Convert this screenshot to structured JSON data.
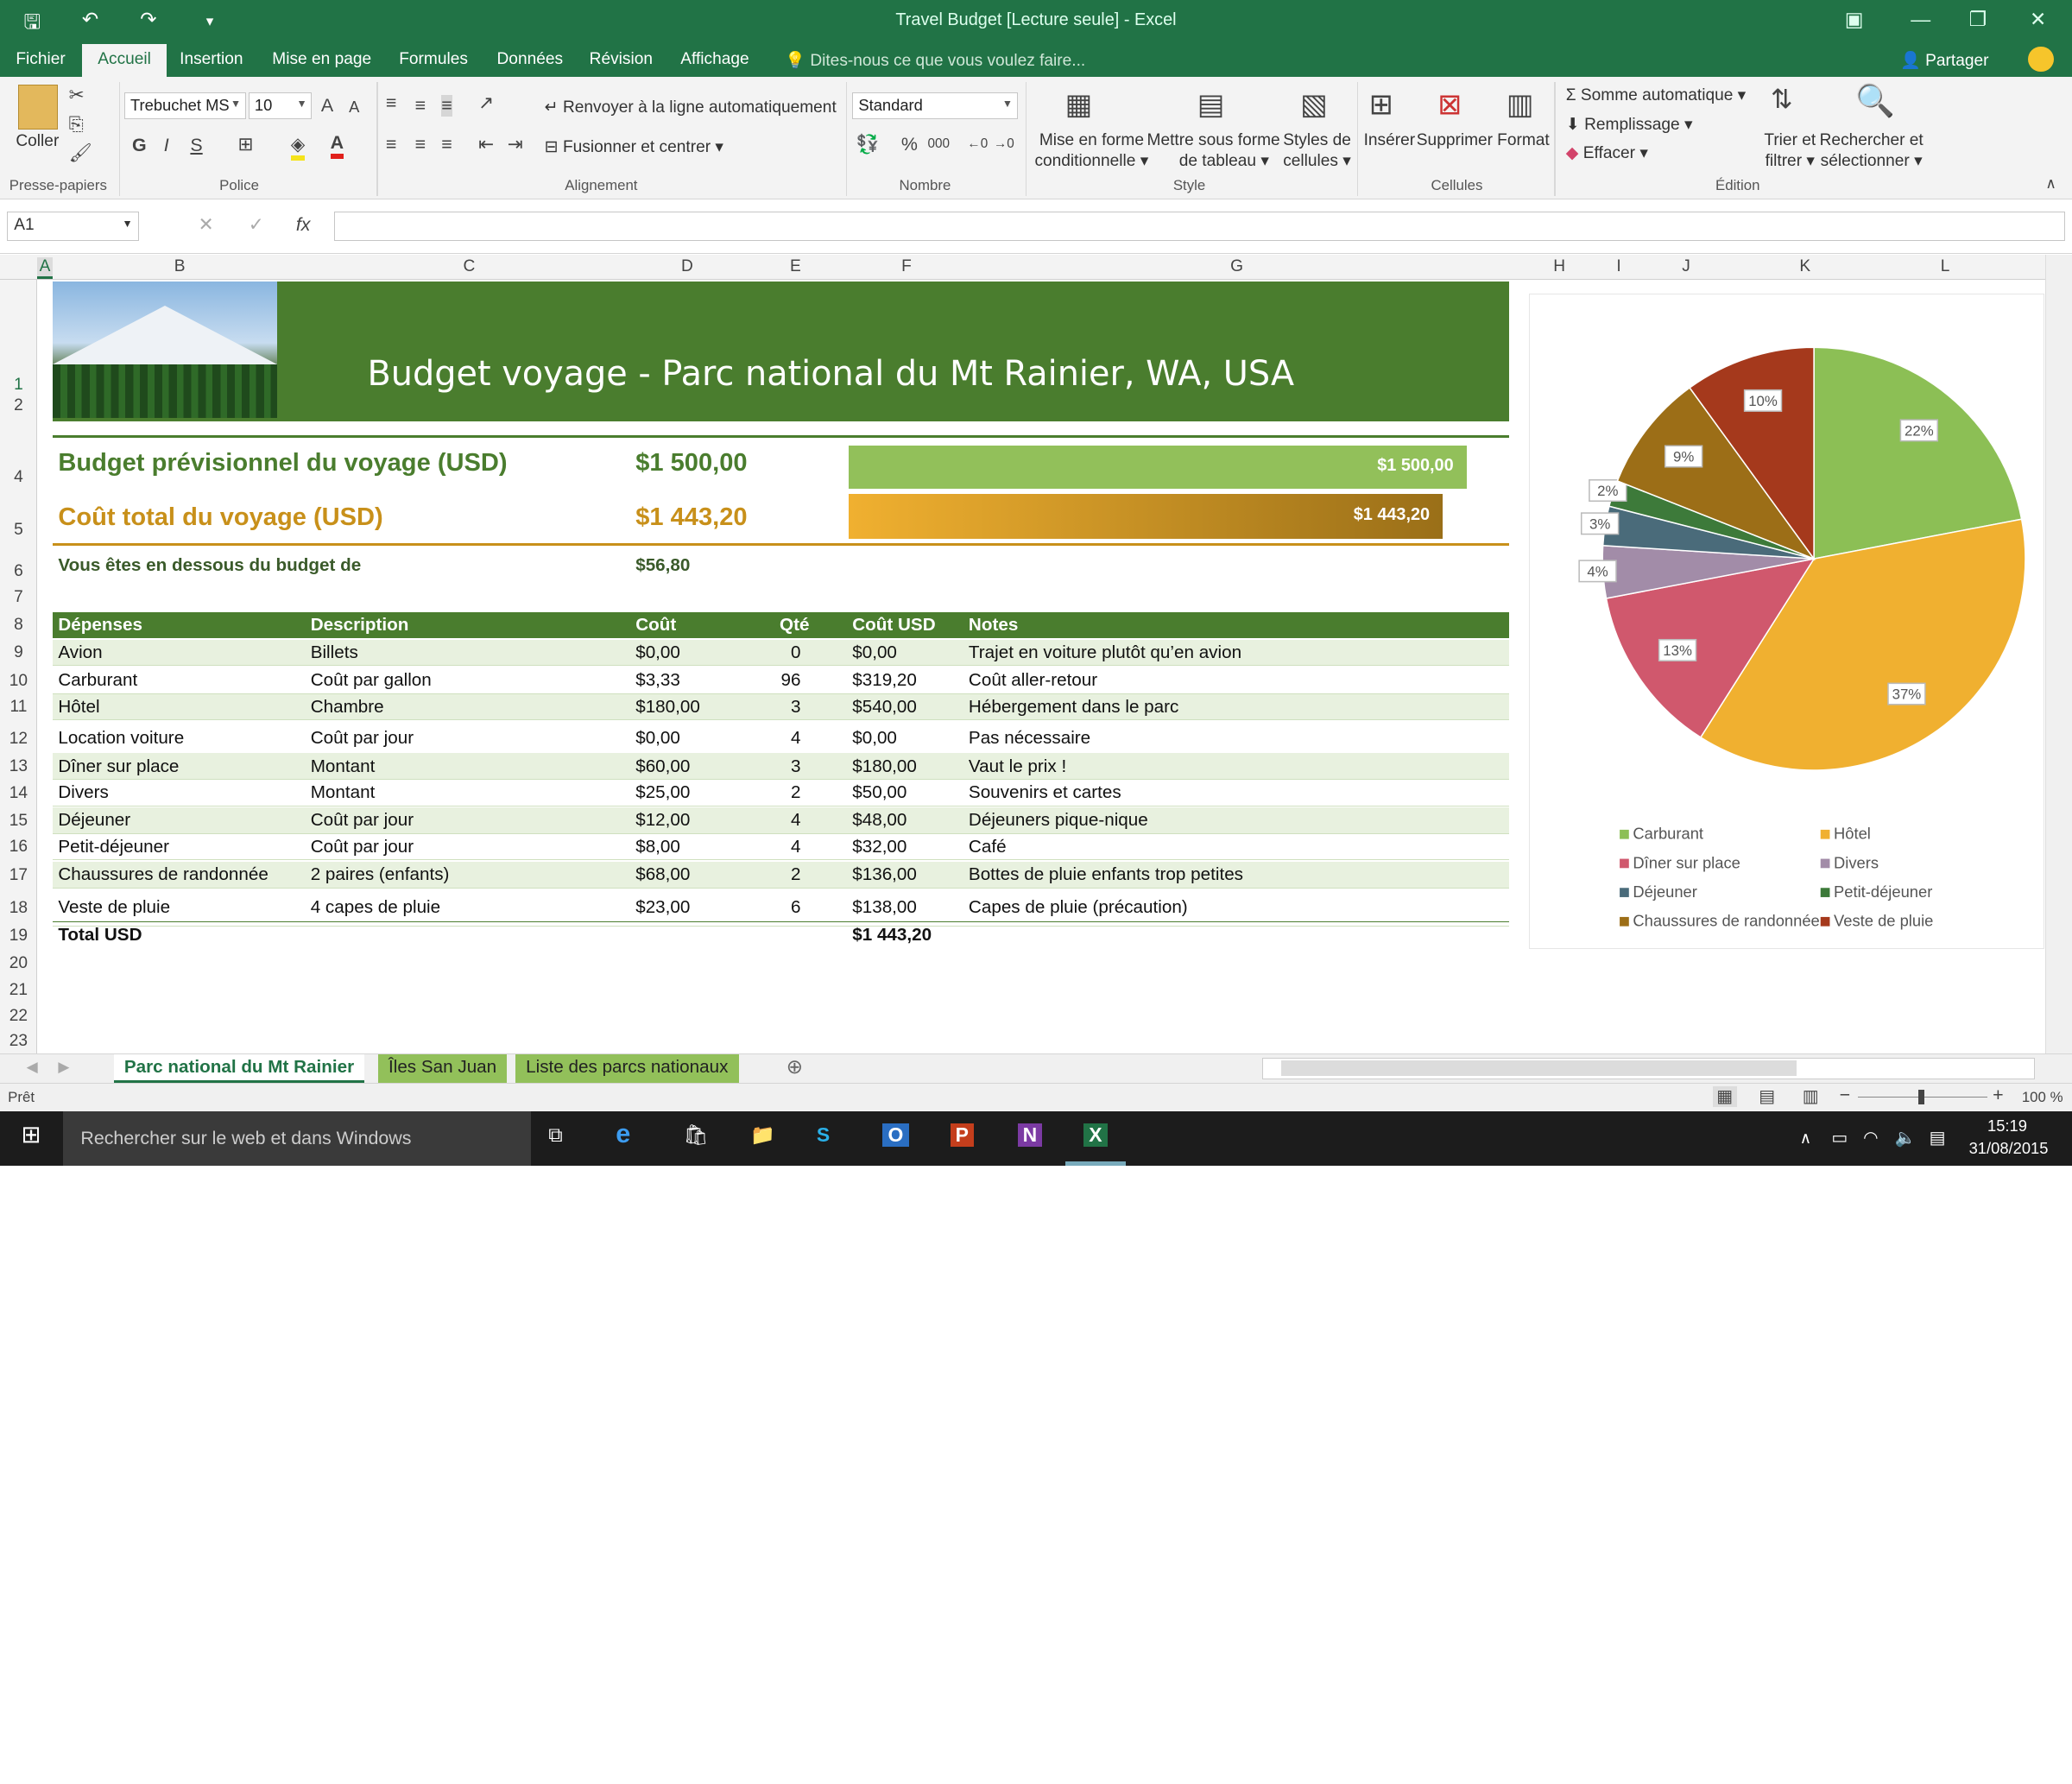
{
  "window": {
    "title": "Travel Budget  [Lecture seule] - Excel"
  },
  "menu": {
    "file": "Fichier",
    "home": "Accueil",
    "insert": "Insertion",
    "layout": "Mise en page",
    "formulas": "Formules",
    "data": "Données",
    "review": "Révision",
    "view": "Affichage",
    "tellme": "Dites-nous ce que vous voulez faire...",
    "share": "Partager"
  },
  "ribbon": {
    "paste": "Coller",
    "font_name": "Trebuchet MS",
    "font_size": "10",
    "wrap": "Renvoyer à la ligne automatiquement",
    "merge": "Fusionner et centrer",
    "number_format": "Standard",
    "cond_format": "Mise en forme",
    "cond_format2": "conditionnelle",
    "format_table": "Mettre sous forme",
    "format_table2": "de tableau",
    "cell_styles": "Styles de",
    "cell_styles2": "cellules",
    "insert": "Insérer",
    "delete": "Supprimer",
    "format": "Format",
    "autosum": "Somme automatique",
    "fill": "Remplissage",
    "clear": "Effacer",
    "sort": "Trier et",
    "sort2": "filtrer",
    "find": "Rechercher et",
    "find2": "sélectionner",
    "groups": {
      "clipboard": "Presse-papiers",
      "font": "Police",
      "alignment": "Alignement",
      "number": "Nombre",
      "style": "Style",
      "cells": "Cellules",
      "editing": "Édition"
    }
  },
  "formula_bar": {
    "name_box": "A1",
    "value": ""
  },
  "columns": [
    "A",
    "B",
    "C",
    "D",
    "E",
    "F",
    "G",
    "H",
    "I",
    "J",
    "K",
    "L"
  ],
  "rows": [
    "1",
    "2",
    "4",
    "5",
    "6",
    "7",
    "8",
    "9",
    "10",
    "11",
    "12",
    "13",
    "14",
    "15",
    "16",
    "17",
    "18",
    "19",
    "20",
    "21",
    "22",
    "23"
  ],
  "sheet": {
    "title": "Budget voyage - Parc national du Mt Rainier, WA, USA",
    "budget_label": "Budget prévisionnel du voyage (USD)",
    "budget_value": "$1 500,00",
    "budget_bar": "$1 500,00",
    "cost_label": "Coût total du voyage (USD)",
    "cost_value": "$1 443,20",
    "cost_bar": "$1 443,20",
    "under_label": "Vous êtes en dessous du budget de",
    "under_value": "$56,80",
    "bar_fraction_budget": 1.0,
    "bar_fraction_cost": 0.962,
    "table_headers": [
      "Dépenses",
      "Description",
      "Coût",
      "Qté",
      "Coût USD",
      "Notes"
    ],
    "table_rows": [
      [
        "Avion",
        "Billets",
        "$0,00",
        "0",
        "$0,00",
        "Trajet en voiture plutôt qu’en avion"
      ],
      [
        "Carburant",
        "Coût par gallon",
        "$3,33",
        "96",
        "$319,20",
        "Coût aller-retour"
      ],
      [
        "Hôtel",
        "Chambre",
        "$180,00",
        "3",
        "$540,00",
        "Hébergement dans le parc"
      ],
      [
        "Location voiture",
        "Coût par jour",
        "$0,00",
        "4",
        "$0,00",
        "Pas nécessaire"
      ],
      [
        "Dîner sur place",
        "Montant",
        "$60,00",
        "3",
        "$180,00",
        "Vaut le prix !"
      ],
      [
        "Divers",
        "Montant",
        "$25,00",
        "2",
        "$50,00",
        "Souvenirs et cartes"
      ],
      [
        "Déjeuner",
        "Coût par jour",
        "$12,00",
        "4",
        "$48,00",
        "Déjeuners pique-nique"
      ],
      [
        "Petit-déjeuner",
        "Coût par jour",
        "$8,00",
        "4",
        "$32,00",
        "Café"
      ],
      [
        "Chaussures de randonnée",
        "2 paires (enfants)",
        "$68,00",
        "2",
        "$136,00",
        "Bottes de pluie enfants trop petites"
      ],
      [
        "Veste de pluie",
        "4 capes de pluie",
        "$23,00",
        "6",
        "$138,00",
        "Capes de pluie (précaution)"
      ]
    ],
    "total_label": "Total USD",
    "total_value": "$1 443,20"
  },
  "chart_data": {
    "type": "pie",
    "categories": [
      "Carburant",
      "Hôtel",
      "Dîner sur place",
      "Divers",
      "Déjeuner",
      "Petit-déjeuner",
      "Chaussures de randonnée",
      "Veste de pluie"
    ],
    "values": [
      22,
      37,
      13,
      4,
      3,
      2,
      9,
      10
    ],
    "labels": [
      "22%",
      "37%",
      "13%",
      "4%",
      "3%",
      "2%",
      "9%",
      "10%"
    ],
    "colors": [
      "#8cbf55",
      "#f0b030",
      "#d0586d",
      "#a28ca8",
      "#4a6b7a",
      "#3d7a3a",
      "#9c6e17",
      "#a5391c"
    ],
    "legend_position": "bottom"
  },
  "tabs": [
    "Parc national du Mt Rainier",
    "Îles San Juan",
    "Liste des parcs nationaux"
  ],
  "status": {
    "ready": "Prêt",
    "zoom": "100 %"
  },
  "taskbar": {
    "search": "Rechercher sur le web et dans Windows",
    "time": "15:19",
    "date": "31/08/2015"
  }
}
